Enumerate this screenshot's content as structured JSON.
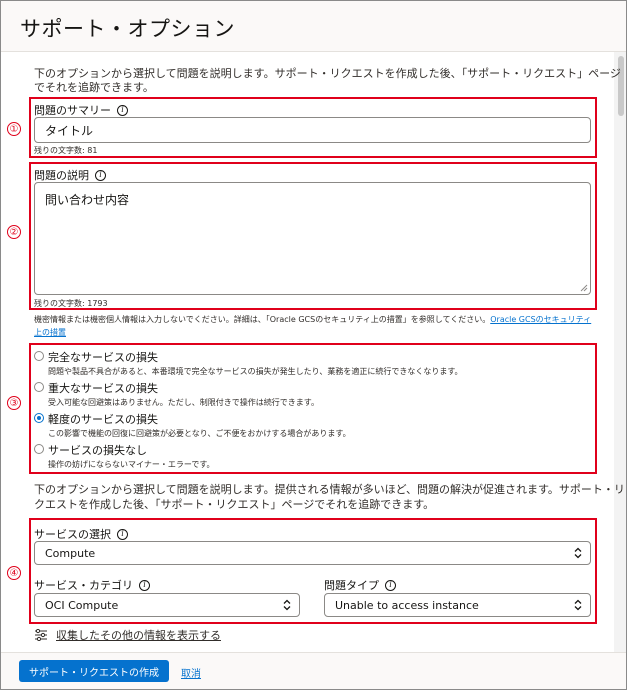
{
  "header": {
    "title": "サポート・オプション"
  },
  "intro_text_line1": "下のオプションから選択して問題を説明します。サポート・リクエストを作成した後、「サポート・リクエスト」ページ",
  "intro_text_line2": "でそれを追跡できます。",
  "summary": {
    "marker": "①",
    "label": "問題のサマリー",
    "value": "タイトル",
    "remaining": "残りの文字数: 81"
  },
  "description": {
    "marker": "②",
    "label": "問題の説明",
    "value": "問い合わせ内容",
    "remaining": "残りの文字数: 1793",
    "notice": "機密情報または機密個人情報は入力しないでください。詳細は、「Oracle GCSのセキュリティ上の措置」を参照してください。",
    "notice_link_1": "Oracle GCSのセキュリティ",
    "notice_link_2": "上の措置"
  },
  "severity": {
    "marker": "③",
    "options": [
      {
        "title": "完全なサービスの損失",
        "desc": "問題や製品不具合があると、本番環境で完全なサービスの損失が発生したり、業務を適正に続行できなくなります。",
        "checked": false
      },
      {
        "title": "重大なサービスの損失",
        "desc": "受入可能な回避策はありません。ただし、制限付きで操作は続行できます。",
        "checked": false
      },
      {
        "title": "軽度のサービスの損失",
        "desc": "この影響で機能の回復に回避策が必要となり、ご不便をおかけする場合があります。",
        "checked": true
      },
      {
        "title": "サービスの損失なし",
        "desc": "操作の妨げにならないマイナー・エラーです。",
        "checked": false
      }
    ]
  },
  "second_text_line1": "下のオプションから選択して問題を説明します。提供される情報が多いほど、問題の解決が促進されます。サポート・リ",
  "second_text_line2": "クエストを作成した後、「サポート・リクエスト」ページでそれを追跡できます。",
  "service": {
    "marker": "④",
    "select_label": "サービスの選択",
    "select_value": "Compute",
    "category_label": "サービス・カテゴリ",
    "category_value": "OCI Compute",
    "type_label": "問題タイプ",
    "type_value": "Unable to access instance"
  },
  "more_info_label": "収集したその他の情報を表示する",
  "footer": {
    "create_label": "サポート・リクエストの作成",
    "cancel_label": "取消"
  },
  "colors": {
    "accent": "#0572ce",
    "annotation": "#e0001b"
  }
}
